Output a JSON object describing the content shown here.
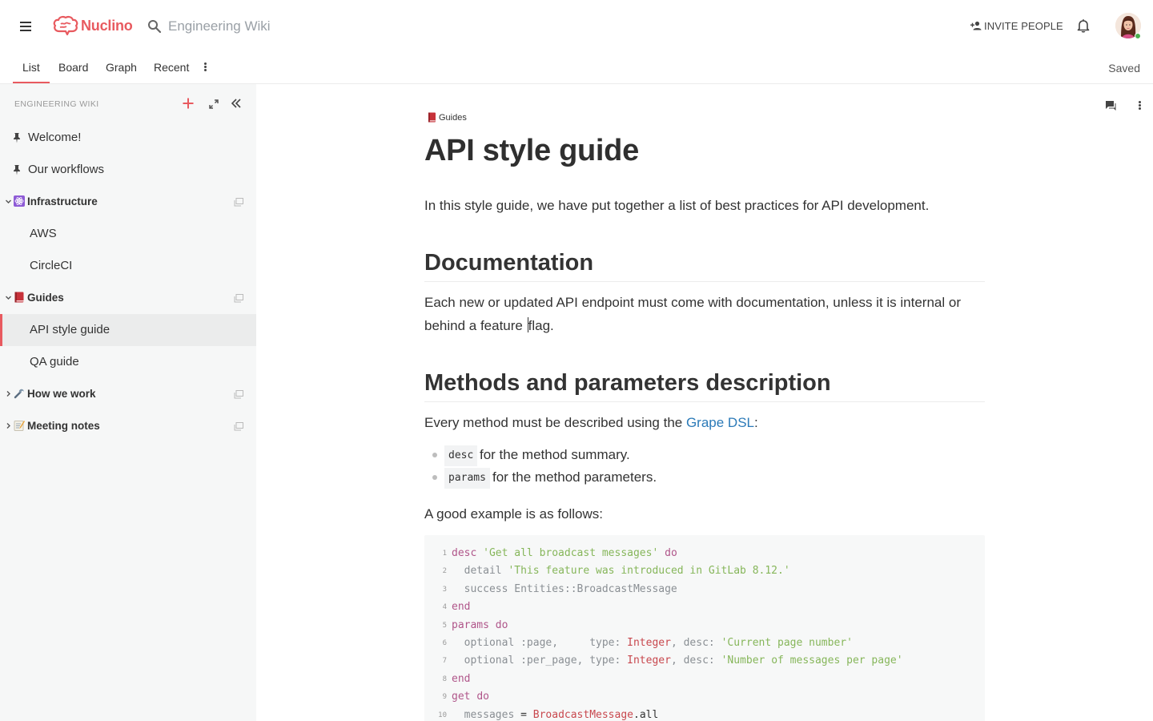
{
  "header": {
    "brand": "Nuclino",
    "search_placeholder": "Engineering Wiki",
    "invite_label": "INVITE PEOPLE"
  },
  "tabs": [
    {
      "label": "List",
      "active": true
    },
    {
      "label": "Board",
      "active": false
    },
    {
      "label": "Graph",
      "active": false
    },
    {
      "label": "Recent",
      "active": false
    }
  ],
  "status": "Saved",
  "sidebar": {
    "title": "ENGINEERING WIKI",
    "items": [
      {
        "label": "Welcome!",
        "type": "pinned"
      },
      {
        "label": "Our workflows",
        "type": "pinned"
      },
      {
        "label": "Infrastructure",
        "type": "collection",
        "expanded": true,
        "icon": "atom-icon"
      },
      {
        "label": "AWS",
        "type": "child"
      },
      {
        "label": "CircleCI",
        "type": "child"
      },
      {
        "label": "Guides",
        "type": "collection",
        "expanded": true,
        "icon": "book-icon"
      },
      {
        "label": "API style guide",
        "type": "child",
        "active": true
      },
      {
        "label": "QA guide",
        "type": "child"
      },
      {
        "label": "How we work",
        "type": "collection",
        "expanded": false,
        "icon": "wrench-icon"
      },
      {
        "label": "Meeting notes",
        "type": "collection",
        "expanded": false,
        "icon": "memo-icon"
      }
    ]
  },
  "document": {
    "breadcrumb": "Guides",
    "title": "API style guide",
    "intro": "In this style guide, we have put together a list of best practices for API development.",
    "sections": [
      {
        "heading": "Documentation",
        "paragraph_before_caret": "Each new or updated API endpoint must come with documentation, unless it is internal or behind a feature ",
        "paragraph_after_caret": "flag."
      },
      {
        "heading": "Methods and parameters description",
        "paragraph_prefix": "Every method must be described using the ",
        "link_text": "Grape DSL",
        "paragraph_suffix": ":"
      }
    ],
    "bullets": [
      {
        "code": "desc",
        "text": "for the method summary."
      },
      {
        "code": "params",
        "text": "for the method parameters."
      }
    ],
    "example_intro": "A good example is as follows:",
    "code_lines": [
      {
        "n": "1",
        "tokens": [
          [
            "kw",
            "desc"
          ],
          [
            "dk",
            " "
          ],
          [
            "str",
            "'Get all broadcast messages'"
          ],
          [
            "dk",
            " "
          ],
          [
            "kw",
            "do"
          ]
        ]
      },
      {
        "n": "2",
        "tokens": [
          [
            "dk",
            "  "
          ],
          [
            "id",
            "detail"
          ],
          [
            "dk",
            " "
          ],
          [
            "str",
            "'This feature was introduced in GitLab 8.12.'"
          ]
        ]
      },
      {
        "n": "3",
        "tokens": [
          [
            "dk",
            "  "
          ],
          [
            "id",
            "success Entities::BroadcastMessage"
          ]
        ]
      },
      {
        "n": "4",
        "tokens": [
          [
            "kw",
            "end"
          ]
        ]
      },
      {
        "n": "5",
        "tokens": [
          [
            "kw",
            "params"
          ],
          [
            "dk",
            " "
          ],
          [
            "kw",
            "do"
          ]
        ]
      },
      {
        "n": "6",
        "tokens": [
          [
            "dk",
            "  "
          ],
          [
            "id",
            "optional :page,     type: "
          ],
          [
            "cls",
            "Integer"
          ],
          [
            "id",
            ", desc: "
          ],
          [
            "str",
            "'Current page number'"
          ]
        ]
      },
      {
        "n": "7",
        "tokens": [
          [
            "dk",
            "  "
          ],
          [
            "id",
            "optional :per_page, type: "
          ],
          [
            "cls",
            "Integer"
          ],
          [
            "id",
            ", desc: "
          ],
          [
            "str",
            "'Number of messages per page'"
          ]
        ]
      },
      {
        "n": "8",
        "tokens": [
          [
            "kw",
            "end"
          ]
        ]
      },
      {
        "n": "9",
        "tokens": [
          [
            "kw",
            "get"
          ],
          [
            "dk",
            " "
          ],
          [
            "kw",
            "do"
          ]
        ]
      },
      {
        "n": "10",
        "tokens": [
          [
            "dk",
            "  "
          ],
          [
            "id",
            "messages"
          ],
          [
            "dk",
            " = "
          ],
          [
            "cls",
            "BroadcastMessage"
          ],
          [
            "dk",
            ".all"
          ]
        ]
      }
    ]
  },
  "colors": {
    "accent": "#e85a5f",
    "link": "#2b7ab8",
    "sidebar_bg": "#f6f7f7"
  }
}
